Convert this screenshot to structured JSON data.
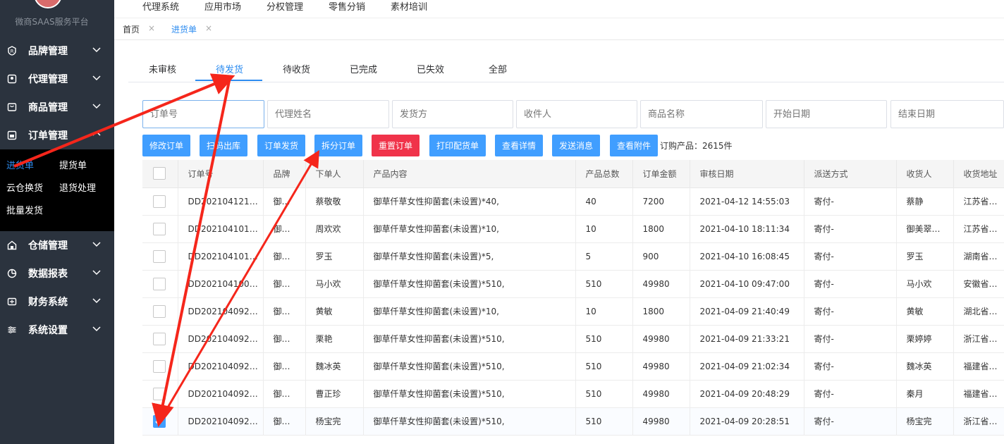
{
  "sidebar": {
    "platform_name": "微商SAAS服务平台",
    "menu": [
      {
        "label": "品牌管理",
        "icon": "brand-icon"
      },
      {
        "label": "代理管理",
        "icon": "agent-icon"
      },
      {
        "label": "商品管理",
        "icon": "goods-icon"
      },
      {
        "label": "订单管理",
        "icon": "order-icon"
      },
      {
        "label": "仓储管理",
        "icon": "warehouse-icon"
      },
      {
        "label": "数据报表",
        "icon": "chart-pie-icon"
      },
      {
        "label": "财务系统",
        "icon": "finance-icon"
      },
      {
        "label": "系统设置",
        "icon": "settings-sliders-icon"
      }
    ],
    "order_submenu": [
      "进货单",
      "提货单",
      "云仓换货",
      "退货处理",
      "批量发货"
    ],
    "active_submenu": "进货单"
  },
  "topnav": [
    "代理系统",
    "应用市场",
    "分权管理",
    "零售分销",
    "素材培训"
  ],
  "tabs": {
    "home": "首页",
    "current": "进货单",
    "close": "×"
  },
  "status_tabs": [
    "未审核",
    "待发货",
    "待收货",
    "已完成",
    "已失效",
    "全部"
  ],
  "active_status_tab": "待发货",
  "filters": {
    "order_no": "订单号",
    "agent_name": "代理姓名",
    "shipper": "发货方",
    "receiver": "收件人",
    "product_name": "商品名称",
    "start_date": "开始日期",
    "end_date": "结束日期"
  },
  "actions": {
    "modify": "修改订单",
    "scan_out": "扫码出库",
    "ship": "订单发货",
    "split": "拆分订单",
    "reset": "重置订单",
    "print": "打印配货单",
    "details": "查看详情",
    "message": "发送消息",
    "attachments": "查看附件"
  },
  "summary": "订购产品：2615件",
  "table": {
    "columns": [
      "订单号",
      "品牌",
      "下单人",
      "产品内容",
      "产品总数",
      "订单金额",
      "审核日期",
      "派送方式",
      "收货人",
      "收货地址"
    ],
    "rows": [
      {
        "order": "DD202104121…",
        "brand": "御…",
        "buyer": "蔡敬敬",
        "product": "御草仟草女性抑菌套(未设置)*40,",
        "qty": "40",
        "amount": "7200",
        "date": "2021-04-12 14:55:03",
        "ship": "寄付-",
        "receiver": "蔡静",
        "address": "江苏省苏州市",
        "checked": false
      },
      {
        "order": "DD202104101…",
        "brand": "御…",
        "buyer": "周欢欢",
        "product": "御草仟草女性抑菌套(未设置)*10,",
        "qty": "10",
        "amount": "1800",
        "date": "2021-04-10 18:11:34",
        "ship": "寄付-",
        "receiver": "御美翠…",
        "address": "江苏省苏州市",
        "checked": false
      },
      {
        "order": "DD202104101…",
        "brand": "御…",
        "buyer": "罗玉",
        "product": "御草仟草女性抑菌套(未设置)*5,",
        "qty": "5",
        "amount": "900",
        "date": "2021-04-10 16:08:45",
        "ship": "寄付-",
        "receiver": "罗玉",
        "address": "湖南省湘西",
        "checked": false
      },
      {
        "order": "DD202104100…",
        "brand": "御…",
        "buyer": "马小欢",
        "product": "御草仟草女性抑菌套(未设置)*510,",
        "qty": "510",
        "amount": "49980",
        "date": "2021-04-10 09:47:00",
        "ship": "寄付-",
        "receiver": "马小欢",
        "address": "安徽省阜阳",
        "checked": false
      },
      {
        "order": "DD202104092…",
        "brand": "御…",
        "buyer": "黄敏",
        "product": "御草仟草女性抑菌套(未设置)*10,",
        "qty": "10",
        "amount": "1800",
        "date": "2021-04-09 21:40:49",
        "ship": "寄付-",
        "receiver": "黄敏",
        "address": "湖北省恩施",
        "checked": false
      },
      {
        "order": "DD202104092…",
        "brand": "御…",
        "buyer": "栗艳",
        "product": "御草仟草女性抑菌套(未设置)*510,",
        "qty": "510",
        "amount": "49980",
        "date": "2021-04-09 21:33:21",
        "ship": "寄付-",
        "receiver": "栗婷婷",
        "address": "浙江省嘉兴",
        "checked": false
      },
      {
        "order": "DD202104092…",
        "brand": "御…",
        "buyer": "魏冰英",
        "product": "御草仟草女性抑菌套(未设置)*510,",
        "qty": "510",
        "amount": "49980",
        "date": "2021-04-09 21:02:34",
        "ship": "寄付-",
        "receiver": "魏冰英",
        "address": "福建省莆田",
        "checked": false
      },
      {
        "order": "DD202104092…",
        "brand": "御…",
        "buyer": "曹正珍",
        "product": "御草仟草女性抑菌套(未设置)*510,",
        "qty": "510",
        "amount": "49980",
        "date": "2021-04-09 20:48:29",
        "ship": "寄付-",
        "receiver": "秦月",
        "address": "福建省厦门",
        "checked": false
      },
      {
        "order": "DD202104092…",
        "brand": "御…",
        "buyer": "杨宝完",
        "product": "御草仟草女性抑菌套(未设置)*510,",
        "qty": "510",
        "amount": "49980",
        "date": "2021-04-09 20:28:51",
        "ship": "寄付-",
        "receiver": "杨宝完",
        "address": "浙江省温州",
        "checked": true
      }
    ]
  },
  "colors": {
    "sidebar_bg": "#2b333e",
    "primary": "#409eff",
    "danger": "#f0334a",
    "active_tab": "#2d8cf0",
    "annotation_arrow": "#f5261b"
  }
}
